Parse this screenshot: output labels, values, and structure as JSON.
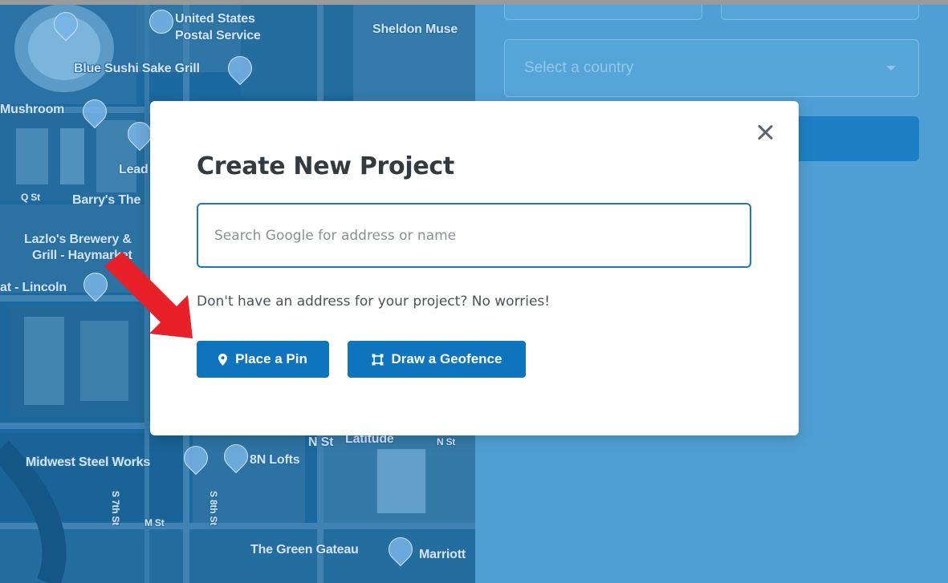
{
  "map": {
    "labels": [
      "United States",
      "Postal Service",
      "Sheldon Muse",
      "Blue Sushi Sake Grill",
      "Mushroom",
      "Lead",
      "Q St",
      "Barry's The",
      "Lazlo's Brewery &",
      "Grill - Haymarket",
      "at - Lincoln",
      "N St",
      "Latitude",
      "N St",
      "Midwest Steel Works",
      "8N Lofts",
      "S 7th St",
      "M St",
      "S 8th St",
      "The Green Gateau",
      "Marriott"
    ]
  },
  "form": {
    "country_placeholder": "Select a country"
  },
  "modal": {
    "title": "Create New Project",
    "search_placeholder": "Search Google for address or name",
    "hint": "Don't have an address for your project? No worries!",
    "place_pin_label": "Place a Pin",
    "geofence_label": "Draw a Geofence"
  },
  "colors": {
    "primary": "#0d74bd",
    "overlay": "#4f9fd4",
    "arrow": "#e8202a"
  }
}
